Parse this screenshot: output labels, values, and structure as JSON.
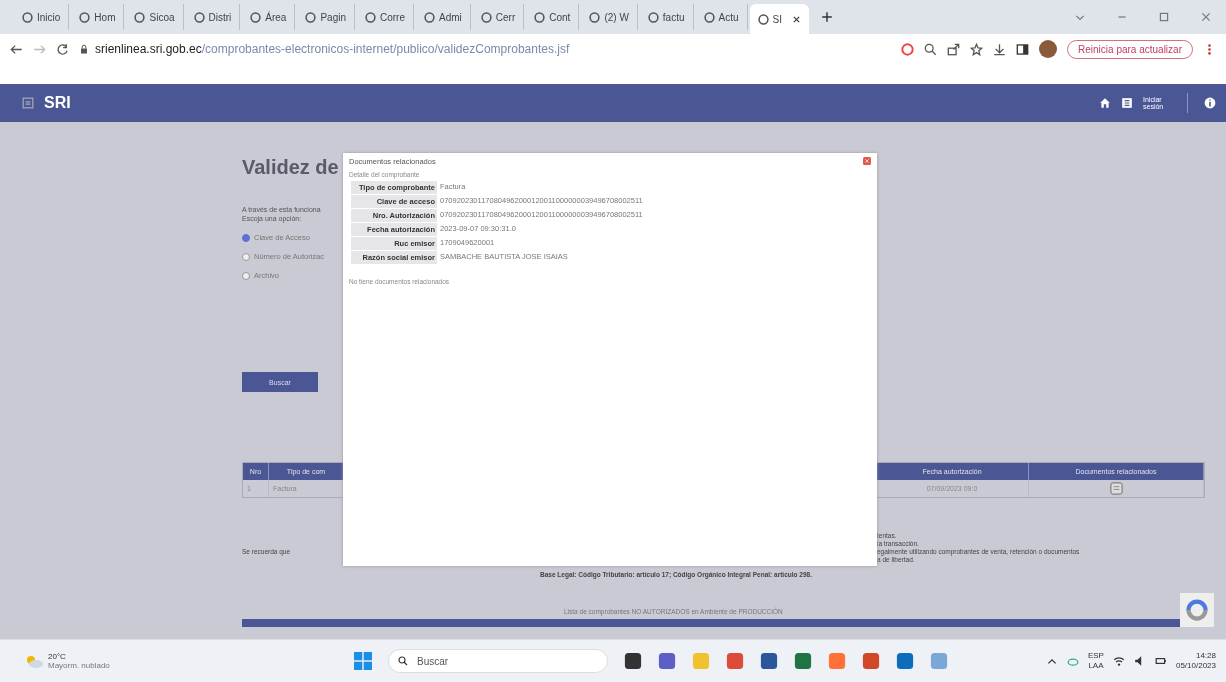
{
  "browser": {
    "tabs": [
      {
        "label": "Inicio",
        "selected": false
      },
      {
        "label": "Hom",
        "selected": false
      },
      {
        "label": "Sicoa",
        "selected": false
      },
      {
        "label": "Distri",
        "selected": false
      },
      {
        "label": "Área",
        "selected": false
      },
      {
        "label": "Pagin",
        "selected": false
      },
      {
        "label": "Corre",
        "selected": false
      },
      {
        "label": "Admi",
        "selected": false
      },
      {
        "label": "Cerr",
        "selected": false
      },
      {
        "label": "Cont",
        "selected": false
      },
      {
        "label": "(2) W",
        "selected": false
      },
      {
        "label": "factu",
        "selected": false
      },
      {
        "label": "Actu",
        "selected": false
      },
      {
        "label": "SI",
        "selected": true
      }
    ],
    "url": {
      "domain": "srienlinea.sri.gob.ec",
      "path": "/comprobantes-electronicos-internet/publico/validezComprobantes.jsf"
    },
    "update_button": "Reinicia para actualizar"
  },
  "header": {
    "logo": "SRI",
    "login_label": "Iniciar sesión"
  },
  "page": {
    "title": "Validez de",
    "intro": "A través de esta funciona",
    "prompt": "Escoja una opción:",
    "options": [
      {
        "label": "Clave de Acceso",
        "selected": true
      },
      {
        "label": "Número de Autorizac",
        "selected": false
      },
      {
        "label": "Archivo",
        "selected": false
      }
    ],
    "search_button": "Buscar",
    "table": {
      "columns": [
        "Nro",
        "Tipo de com",
        "Fecha autorización",
        "Documentos relacionados"
      ],
      "rows": [
        {
          "nro": "1",
          "tipo": "Factura",
          "fecha": "07/09/2023 09:0"
        }
      ]
    },
    "notes_left": "Se recuerda que",
    "notes_right": [
      "tentas.",
      "la transacción.",
      "egalmente utilizando comprobantes de venta, retención o documentos",
      "a de libertad."
    ],
    "legal": "Base Legal: Código Tributario: artículo 17; Código Orgánico Integral Penal: artículo 298.",
    "footer_link": "Lista de comprobantes NO AUTORIZADOS en Ambiente de PRODUCCIÓN"
  },
  "modal": {
    "title": "Documentos relacionados",
    "subtitle": "Detalle del comprobante",
    "fields": [
      {
        "label": "Tipo de comprobante",
        "value": "Factura"
      },
      {
        "label": "Clave de acceso",
        "value": "0709202301170804962000120011000000039496708002511"
      },
      {
        "label": "Nro. Autorización",
        "value": "0709202301170804962000120011000000039496708002511"
      },
      {
        "label": "Fecha autorización",
        "value": "2023-09-07 09:30:31.0"
      },
      {
        "label": "Ruc emisor",
        "value": "1709049620001"
      },
      {
        "label": "Razón social emisor",
        "value": "SAMBACHE BAUTISTA JOSE ISAIAS"
      }
    ],
    "empty_message": "No tiene documentos relacionados"
  },
  "taskbar": {
    "temperature": "20°C",
    "weather": "Mayorm. nublado",
    "search_placeholder": "Buscar",
    "language": "ESP",
    "layout": "LAA",
    "time": "14:28",
    "date": "05/10/2023"
  }
}
